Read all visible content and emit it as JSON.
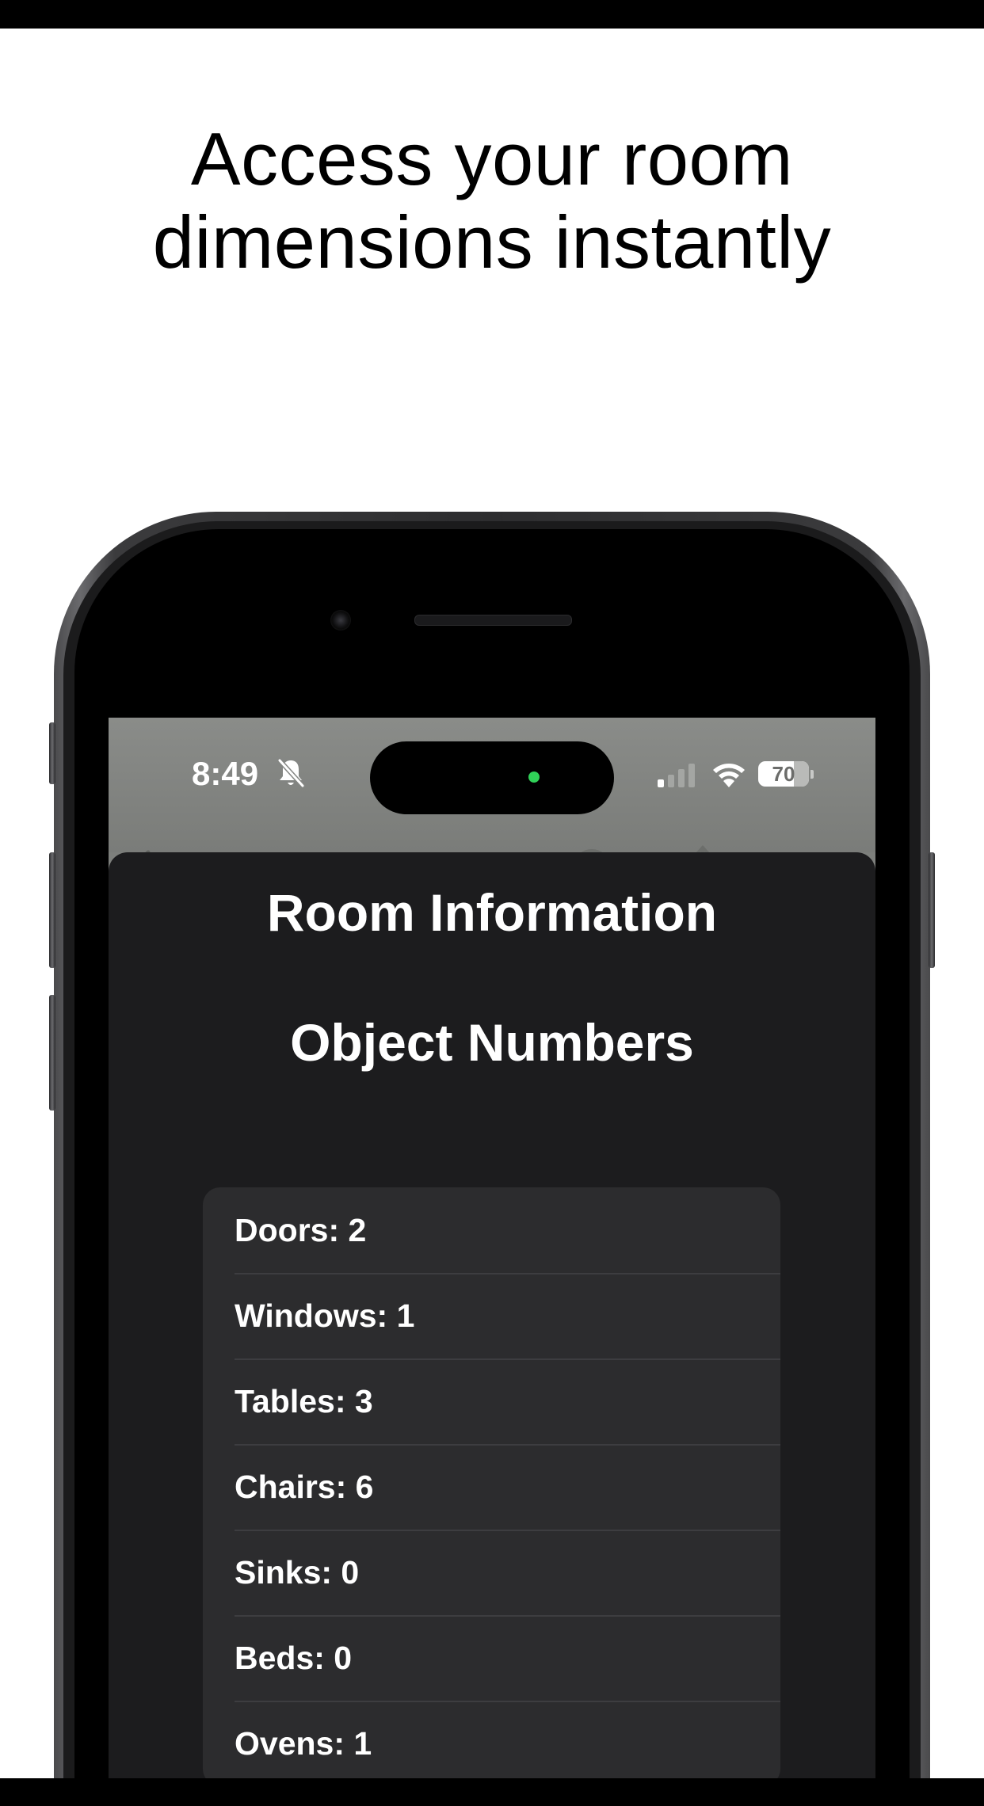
{
  "headline": {
    "line1": "Access your room",
    "line2": "dimensions instantly"
  },
  "status_bar": {
    "time": "8:49",
    "battery_percent": "70",
    "battery_level": 0.7,
    "icons": [
      "bell-slash-icon",
      "cellular-signal-icon",
      "wifi-icon",
      "battery-icon"
    ],
    "privacy_indicator_color": "#30d158"
  },
  "sheet": {
    "title": "Room Information",
    "subtitle": "Object Numbers",
    "items": [
      {
        "label": "Doors: 2"
      },
      {
        "label": "Windows: 1"
      },
      {
        "label": "Tables: 3"
      },
      {
        "label": "Chairs: 6"
      },
      {
        "label": "Sinks: 0"
      },
      {
        "label": "Beds: 0"
      },
      {
        "label": "Ovens: 1"
      }
    ]
  },
  "colors": {
    "sheet_background": "#1c1c1e",
    "list_background": "#2c2c2e",
    "text": "#ffffff"
  }
}
